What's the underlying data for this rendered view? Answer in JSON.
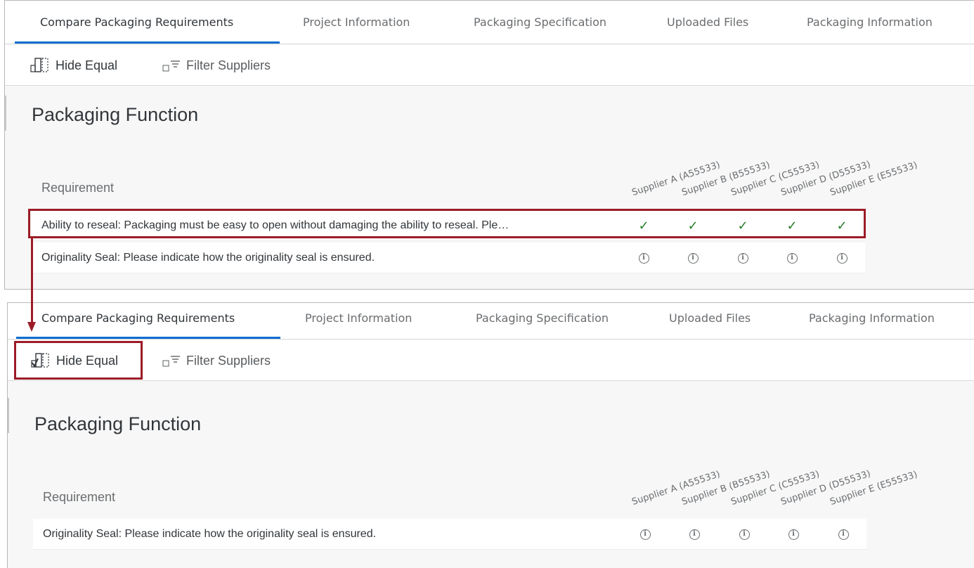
{
  "tabs": [
    {
      "label": "Compare Packaging Requirements",
      "selected": true
    },
    {
      "label": "Project Information",
      "selected": false
    },
    {
      "label": "Packaging Specification",
      "selected": false
    },
    {
      "label": "Uploaded Files",
      "selected": false
    },
    {
      "label": "Packaging Information",
      "selected": false
    }
  ],
  "toolbar": {
    "hide_equal_label": "Hide Equal",
    "filter_label": "Filter Suppliers"
  },
  "section_title": "Packaging Function",
  "requirement_header": "Requirement",
  "suppliers": [
    "Supplier A (A55533)",
    "Supplier B (B55533)",
    "Supplier C (C55533)",
    "Supplier D (D55533)",
    "Supplier E (E55533)"
  ],
  "before": {
    "hide_equal_checked": false,
    "rows": [
      {
        "text": "Ability to reseal: Packaging must be easy to open without damaging the ability to reseal. Ple…",
        "status": [
          "check",
          "check",
          "check",
          "check",
          "check"
        ]
      },
      {
        "text": "Originality Seal: Please indicate how the originality seal is ensured.",
        "status": [
          "info",
          "info",
          "info",
          "info",
          "info"
        ]
      }
    ]
  },
  "after": {
    "hide_equal_checked": true,
    "rows": [
      {
        "text": "Originality Seal: Please indicate how the originality seal is ensured.",
        "status": [
          "info",
          "info",
          "info",
          "info",
          "info"
        ]
      }
    ]
  },
  "icons": {
    "check": "✓",
    "info": "i",
    "highlight_color": "#9b1c27",
    "accent_color": "#0a6ed1",
    "check_color": "#2b7d2b"
  }
}
